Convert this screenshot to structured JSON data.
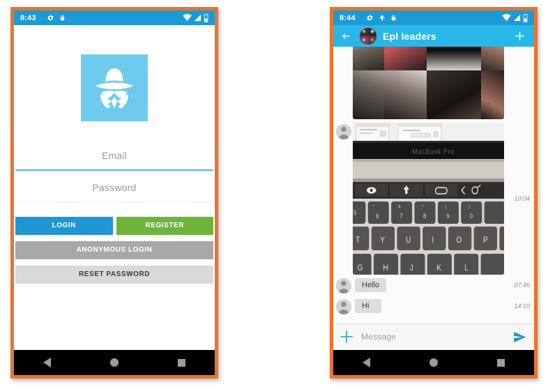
{
  "page": {
    "background": "#ffffff",
    "frame_color": "#e8752a"
  },
  "left_phone": {
    "name": "login-screen",
    "statusbar": {
      "time": "8:43",
      "left_icons": [
        "gear-icon",
        "lock-icon"
      ],
      "right_icons": [
        "wifi-icon",
        "signal-icon",
        "battery-icon"
      ],
      "background": "#1c9ad6"
    },
    "logo": {
      "name": "spy-incognito-logo",
      "background": "#6ecbee",
      "glyph_color": "#ffffff"
    },
    "form": {
      "email": {
        "placeholder": "Email",
        "value": "",
        "focused": true,
        "underline_color": "#5ab4e8"
      },
      "password": {
        "placeholder": "Password",
        "value": "",
        "focused": false,
        "underline_color": "#eaeaea"
      }
    },
    "buttons": {
      "login": {
        "label": "LOGIN",
        "color": "#2196d4",
        "text_color": "#ffffff"
      },
      "register": {
        "label": "REGISTER",
        "color": "#6eb43c",
        "text_color": "#ffffff"
      },
      "anonymous": {
        "label": "ANONYMOUS LOGIN",
        "color": "#a8a8a8",
        "text_color": "#ffffff"
      },
      "reset": {
        "label": "RESET PASSWORD",
        "color": "#d9d9d9",
        "text_color": "#3b3b3b"
      }
    },
    "navbar": {
      "back": "back-icon",
      "home": "home-icon",
      "recents": "recents-icon"
    }
  },
  "right_phone": {
    "name": "chat-screen",
    "statusbar": {
      "time": "8:44",
      "left_icons": [
        "gear-icon",
        "sync-icon",
        "lock-icon"
      ],
      "right_icons": [
        "wifi-icon",
        "signal-icon",
        "battery-icon"
      ],
      "background": "#1c9ad6"
    },
    "appbar": {
      "back_icon": "arrow-left-icon",
      "avatar": "group-avatar",
      "title": "Epl leaders",
      "add_icon": "plus-icon",
      "background": "#29b6e8"
    },
    "messages": [
      {
        "type": "image",
        "name": "collage-photo",
        "description": "dark photo collage",
        "time": "",
        "show_avatar": false
      },
      {
        "type": "image",
        "name": "macbook-photo",
        "description": "MacBook Pro keyboard and touch bar",
        "time": "10:04",
        "show_avatar": true
      },
      {
        "type": "text",
        "text": "Hello",
        "time": "07:46",
        "show_avatar": true
      },
      {
        "type": "text",
        "text": "Hi",
        "time": "14:10",
        "show_avatar": true
      }
    ],
    "composer": {
      "add_icon": "plus-icon",
      "placeholder": "Message",
      "value": "",
      "send_icon": "send-icon",
      "accent": "#3aa5de"
    },
    "navbar": {
      "back": "back-icon",
      "home": "home-icon",
      "recents": "recents-icon"
    }
  }
}
